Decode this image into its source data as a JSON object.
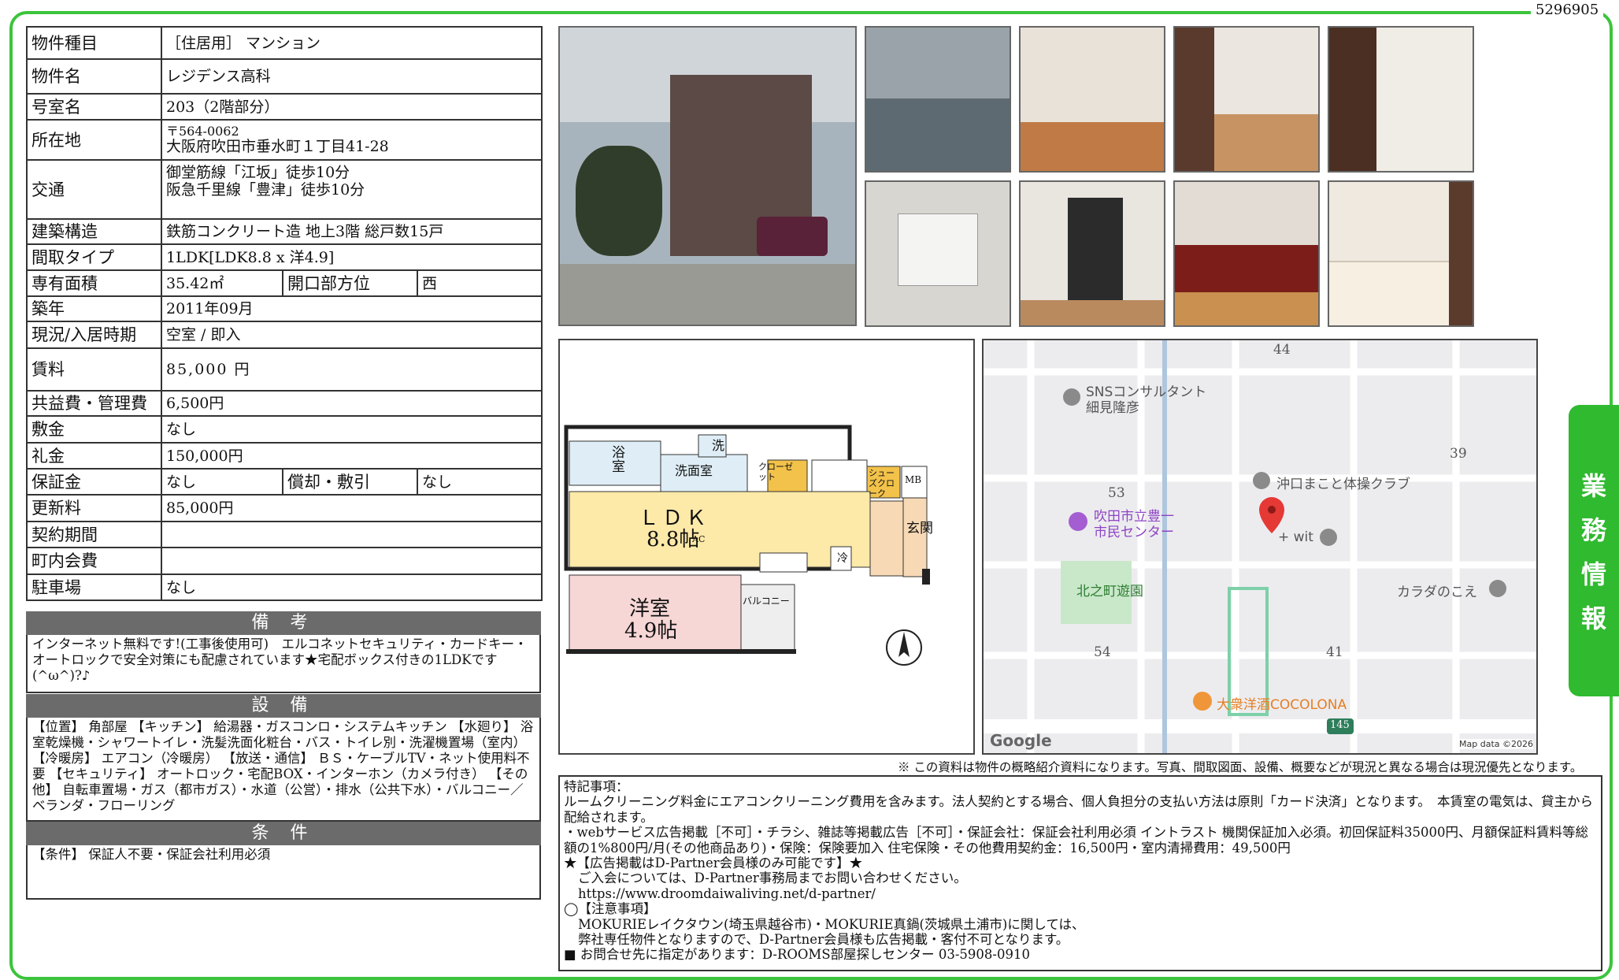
{
  "doc_id": "5296905",
  "side_tab": [
    "業",
    "務",
    "情",
    "報"
  ],
  "property": {
    "type_label": "物件種目",
    "type_value": "［住居用］ マンション",
    "name_label": "物件名",
    "name_value": "レジデンス高科",
    "room_label": "号室名",
    "room_value": "203（2階部分）",
    "address_label": "所在地",
    "postal": "〒564-0062",
    "address": "大阪府吹田市垂水町１丁目41-28",
    "access_label": "交通",
    "access_1": "御堂筋線「江坂」徒歩10分",
    "access_2": "阪急千里線「豊津」徒歩10分",
    "structure_label": "建築構造",
    "structure_value": "鉄筋コンクリート造 地上3階 総戸数15戸",
    "layout_label": "間取タイプ",
    "layout_value": "1LDK[LDK8.8 x 洋4.9]",
    "area_label": "専有面積",
    "area_value": "35.42㎡",
    "direction_label": "開口部方位",
    "direction_value": "西",
    "built_label": "築年",
    "built_value": "2011年09月",
    "status_label": "現況/入居時期",
    "status_value": "空室 / 即入",
    "rent_label": "賃料",
    "rent_value": "85,000 円",
    "fee_label": "共益費・管理費",
    "fee_value": "6,500円",
    "deposit_label": "敷金",
    "deposit_value": "なし",
    "key_money_label": "礼金",
    "key_money_value": "150,000円",
    "security_label": "保証金",
    "security_value": "なし",
    "amort_label": "償却・敷引",
    "amort_value": "なし",
    "renewal_label": "更新料",
    "renewal_value": "85,000円",
    "contract_label": "契約期間",
    "contract_value": "",
    "community_label": "町内会費",
    "community_value": "",
    "parking_label": "駐車場",
    "parking_value": "なし"
  },
  "remarks": {
    "title": "備 考",
    "text": "インターネット無料です!(工事後使用可)　エルコネットセキュリティ・カードキー・オートロックで安全対策にも配慮されています★宅配ボックス付きの1LDKです(^ω^)?♪"
  },
  "facilities": {
    "title": "設 備",
    "text": "【位置】 角部屋 【キッチン】 給湯器・ガスコンロ・システムキッチン 【水廻り】 浴室乾燥機・シャワートイレ・洗髪洗面化粧台・バス・トイレ別・洗濯機置場（室内） 【冷暖房】 エアコン（冷暖房） 【放送・通信】 ＢＳ・ケーブルTV・ネット使用料不要 【セキュリティ】 オートロック・宅配BOX・インターホン（カメラ付き） 【その他】 自転車置場・ガス（都市ガス）・水道（公営）・排水（公共下水）・バルコニー／ベランダ・フローリング"
  },
  "conditions": {
    "title": "条 件",
    "text": "【条件】 保証人不要・保証会社利用必須"
  },
  "floorplan": {
    "bath": "浴室",
    "washroom": "洗面室",
    "wash_mark": "洗",
    "closet": "クローゼット",
    "shoes": "シューズクローク",
    "mb": "MB",
    "ldk": "ＬＤＫ",
    "ldk_size": "8.8帖",
    "ac": "AC",
    "fridge": "冷",
    "entrance": "玄関",
    "western": "洋室",
    "western_size": "4.9帖",
    "balcony": "バルコニー"
  },
  "map": {
    "labels": [
      "44",
      "39",
      "53",
      "54",
      "41",
      "145"
    ],
    "pois": {
      "sns": "SNSコンサルタント\n細見隆彦",
      "gym": "沖口まこと体操クラブ",
      "center": "吹田市立豊一\n市民センター",
      "wit": "+ wit",
      "park": "北之町遊園",
      "karada": "カラダのこえ",
      "cocolona": "大衆洋酒COCOLONA"
    },
    "google": "Google",
    "attribution": "Map data ©2026"
  },
  "disclaimer": "※ この資料は物件の概略紹介資料になります。写真、間取図面、設備、概要などが現況と異なる場合は現況優先となります。",
  "notes": {
    "l1": "特記事項：",
    "l2": "ルームクリーニング料金にエアコンクリーニング費用を含みます。法人契約とする場合、個人負担分の支払い方法は原則「カード決済」となります。　本賃室の電気は、貸主から配給されます。",
    "l3": "・webサービス広告掲載［不可］・チラシ、雑誌等掲載広告［不可］・保証会社：保証会社利用必須 イントラスト 機関保証加入必須。初回保証料35000円、月額保証料賃料等総額の1%800円/月(その他商品あり)・保険：保険要加入 住宅保険・その他費用契約金：16,500円・室内清掃費用：49,500円",
    "l4": "★【広告掲載はD-Partner会員様のみ可能です】★",
    "l5": "ご入会については、D-Partner事務局までお問い合わせください。",
    "l6": "https://www.droomdaiwaliving.net/d-partner/",
    "l7": "◯【注意事項】",
    "l8": "MOKURIEレイクタウン(埼玉県越谷市)・MOKURIE真鍋(茨城県土浦市)に関しては、",
    "l9": "弊社専任物件となりますので、D-Partner会員様も広告掲載・客付不可となります。",
    "l10": "■ お問合せ先に指定があります：D-ROOMS部屋探しセンター 03-5908-0910"
  }
}
